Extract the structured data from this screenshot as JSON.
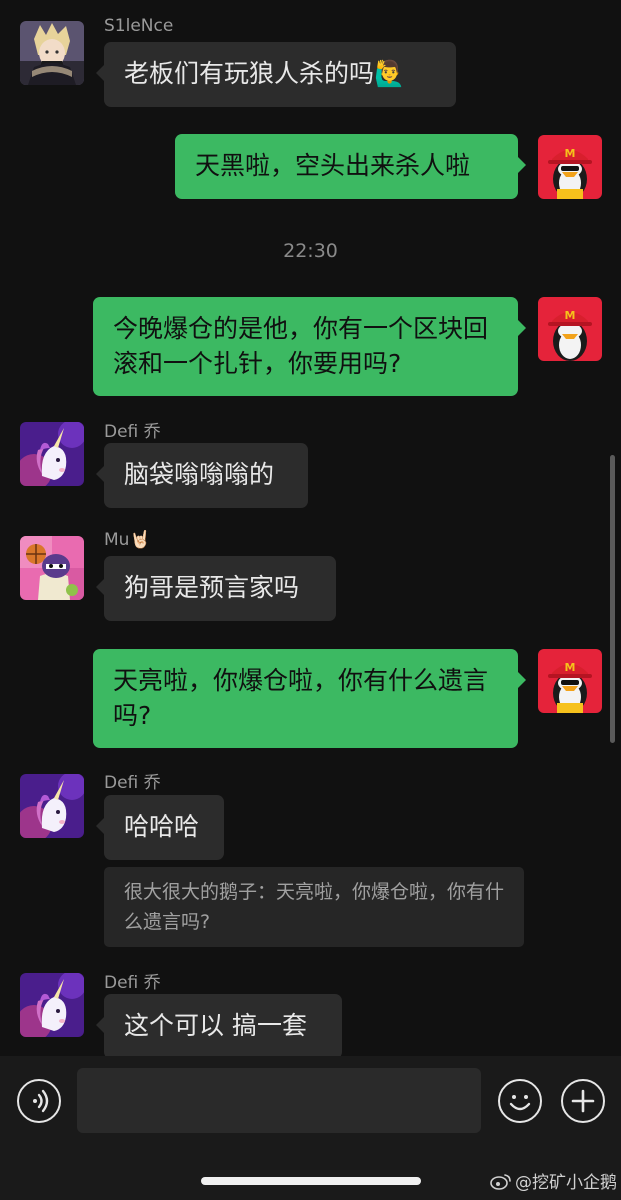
{
  "messages": {
    "m1": {
      "sender": "S1leNce",
      "text": "老板们有玩狼人杀的吗🙋‍♂️"
    },
    "m2": {
      "text": "天黑啦，空头出来杀人啦"
    },
    "timestamp": "22:30",
    "m3": {
      "text": "今晚爆仓的是他，你有一个区块回滚和一个扎针，你要用吗?"
    },
    "m4": {
      "sender": "Defi 乔",
      "text": "脑袋嗡嗡嗡的"
    },
    "m5": {
      "sender": "Mu🤘🏻",
      "text": "狗哥是预言家吗"
    },
    "m6": {
      "text": "天亮啦，你爆仓啦，你有什么遗言吗?"
    },
    "m7": {
      "sender": "Defi 乔",
      "text": "哈哈哈",
      "quote": "很大很大的鹅子：天亮啦，你爆仓啦，你有什么遗言吗?"
    },
    "m8": {
      "sender": "Defi 乔",
      "text": "这个可以 搞一套"
    }
  },
  "input": {
    "placeholder": ""
  },
  "watermark": "@挖矿小企鹅",
  "colors": {
    "background": "#111111",
    "incoming_bubble": "#2c2c2c",
    "outgoing_bubble": "#3cb962"
  },
  "icons": {
    "voice": "voice-icon",
    "emoji": "emoji-icon",
    "add": "plus-icon",
    "weibo": "weibo-icon"
  }
}
